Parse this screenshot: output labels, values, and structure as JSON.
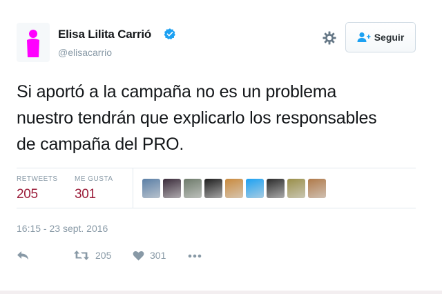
{
  "user": {
    "name": "Elisa Lilita Carrió",
    "handle": "@elisacarrio",
    "verified": true,
    "avatar_color": "#ff00ff"
  },
  "actions_top": {
    "settings_icon": "gear-icon",
    "follow_label": "Seguir",
    "follow_icon": "add-user-icon"
  },
  "tweet": {
    "lines": [
      "Si aportó a la campaña no es un problema",
      "nuestro tendrán que explicarlo los responsables",
      "de campaña del PRO."
    ],
    "timestamp": "16:15 - 23 sept. 2016"
  },
  "stats": {
    "retweets_label": "RETWEETS",
    "retweets_value": "205",
    "likes_label": "ME GUSTA",
    "likes_value": "301",
    "value_color": "#9b1c39"
  },
  "likers": [
    {
      "name": "liker-avatar-1",
      "color": "#5b7fa6"
    },
    {
      "name": "liker-avatar-2",
      "color": "#3a2b3a"
    },
    {
      "name": "liker-avatar-3",
      "color": "#6d7a6a"
    },
    {
      "name": "liker-avatar-4",
      "color": "#1e1e1e"
    },
    {
      "name": "liker-avatar-5",
      "color": "#c98a3e"
    },
    {
      "name": "liker-avatar-6",
      "color": "#1da1f2"
    },
    {
      "name": "liker-avatar-7",
      "color": "#2b2b2b"
    },
    {
      "name": "liker-avatar-8",
      "color": "#9a8f4a"
    },
    {
      "name": "liker-avatar-9",
      "color": "#b07a4a"
    }
  ],
  "footer_actions": {
    "reply_icon": "reply-icon",
    "retweet_icon": "retweet-icon",
    "retweet_count": "205",
    "like_icon": "heart-icon",
    "like_count": "301",
    "more_icon": "more-dots-icon"
  }
}
